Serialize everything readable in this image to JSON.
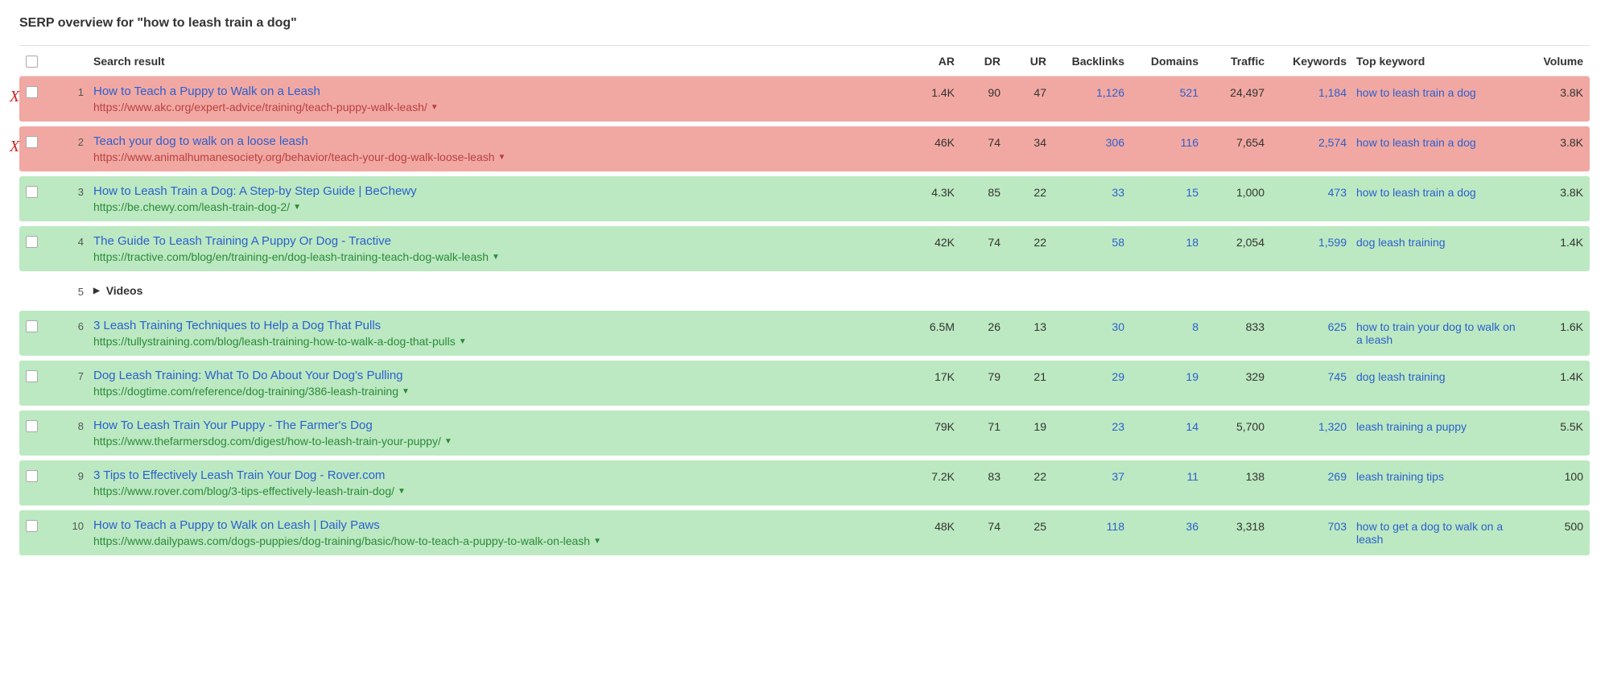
{
  "title": "SERP overview for \"how to leash train a dog\"",
  "columns": {
    "search_result": "Search result",
    "ar": "AR",
    "dr": "DR",
    "ur": "UR",
    "backlinks": "Backlinks",
    "domains": "Domains",
    "traffic": "Traffic",
    "keywords": "Keywords",
    "top_keyword": "Top keyword",
    "volume": "Volume"
  },
  "x_mark": "X",
  "videos_label": "Videos",
  "rows": [
    {
      "type": "result",
      "highlight": "red",
      "x": true,
      "rank": "1",
      "title": "How to Teach a Puppy to Walk on a Leash",
      "url": "https://www.akc.org/expert-advice/training/teach-puppy-walk-leash/",
      "ar": "1.4K",
      "dr": "90",
      "ur": "47",
      "backlinks": "1,126",
      "domains": "521",
      "traffic": "24,497",
      "keywords": "1,184",
      "top_keyword": "how to leash train a dog",
      "volume": "3.8K"
    },
    {
      "type": "result",
      "highlight": "red",
      "x": true,
      "rank": "2",
      "title": "Teach your dog to walk on a loose leash",
      "url": "https://www.animalhumanesociety.org/behavior/teach-your-dog-walk-loose-leash",
      "ar": "46K",
      "dr": "74",
      "ur": "34",
      "backlinks": "306",
      "domains": "116",
      "traffic": "7,654",
      "keywords": "2,574",
      "top_keyword": "how to leash train a dog",
      "volume": "3.8K"
    },
    {
      "type": "result",
      "highlight": "green",
      "x": false,
      "rank": "3",
      "title": "How to Leash Train a Dog: A Step-by Step Guide | BeChewy",
      "url": "https://be.chewy.com/leash-train-dog-2/",
      "ar": "4.3K",
      "dr": "85",
      "ur": "22",
      "backlinks": "33",
      "domains": "15",
      "traffic": "1,000",
      "keywords": "473",
      "top_keyword": "how to leash train a dog",
      "volume": "3.8K"
    },
    {
      "type": "result",
      "highlight": "green",
      "x": false,
      "rank": "4",
      "title": "The Guide To Leash Training A Puppy Or Dog - Tractive",
      "url": "https://tractive.com/blog/en/training-en/dog-leash-training-teach-dog-walk-leash",
      "ar": "42K",
      "dr": "74",
      "ur": "22",
      "backlinks": "58",
      "domains": "18",
      "traffic": "2,054",
      "keywords": "1,599",
      "top_keyword": "dog leash training",
      "volume": "1.4K"
    },
    {
      "type": "videos",
      "rank": "5"
    },
    {
      "type": "result",
      "highlight": "green",
      "x": false,
      "rank": "6",
      "title": "3 Leash Training Techniques to Help a Dog That Pulls",
      "url": "https://tullystraining.com/blog/leash-training-how-to-walk-a-dog-that-pulls",
      "ar": "6.5M",
      "dr": "26",
      "ur": "13",
      "backlinks": "30",
      "domains": "8",
      "traffic": "833",
      "keywords": "625",
      "top_keyword": "how to train your dog to walk on a leash",
      "volume": "1.6K"
    },
    {
      "type": "result",
      "highlight": "green",
      "x": false,
      "rank": "7",
      "title": "Dog Leash Training: What To Do About Your Dog's Pulling",
      "url": "https://dogtime.com/reference/dog-training/386-leash-training",
      "ar": "17K",
      "dr": "79",
      "ur": "21",
      "backlinks": "29",
      "domains": "19",
      "traffic": "329",
      "keywords": "745",
      "top_keyword": "dog leash training",
      "volume": "1.4K"
    },
    {
      "type": "result",
      "highlight": "green",
      "x": false,
      "rank": "8",
      "title": "How To Leash Train Your Puppy - The Farmer's Dog",
      "url": "https://www.thefarmersdog.com/digest/how-to-leash-train-your-puppy/",
      "ar": "79K",
      "dr": "71",
      "ur": "19",
      "backlinks": "23",
      "domains": "14",
      "traffic": "5,700",
      "keywords": "1,320",
      "top_keyword": "leash training a puppy",
      "volume": "5.5K"
    },
    {
      "type": "result",
      "highlight": "green",
      "x": false,
      "rank": "9",
      "title": "3 Tips to Effectively Leash Train Your Dog - Rover.com",
      "url": "https://www.rover.com/blog/3-tips-effectively-leash-train-dog/",
      "ar": "7.2K",
      "dr": "83",
      "ur": "22",
      "backlinks": "37",
      "domains": "11",
      "traffic": "138",
      "keywords": "269",
      "top_keyword": "leash training tips",
      "volume": "100"
    },
    {
      "type": "result",
      "highlight": "green",
      "x": false,
      "rank": "10",
      "title": "How to Teach a Puppy to Walk on Leash | Daily Paws",
      "url": "https://www.dailypaws.com/dogs-puppies/dog-training/basic/how-to-teach-a-puppy-to-walk-on-leash",
      "ar": "48K",
      "dr": "74",
      "ur": "25",
      "backlinks": "118",
      "domains": "36",
      "traffic": "3,318",
      "keywords": "703",
      "top_keyword": "how to get a dog to walk on a leash",
      "volume": "500"
    }
  ]
}
